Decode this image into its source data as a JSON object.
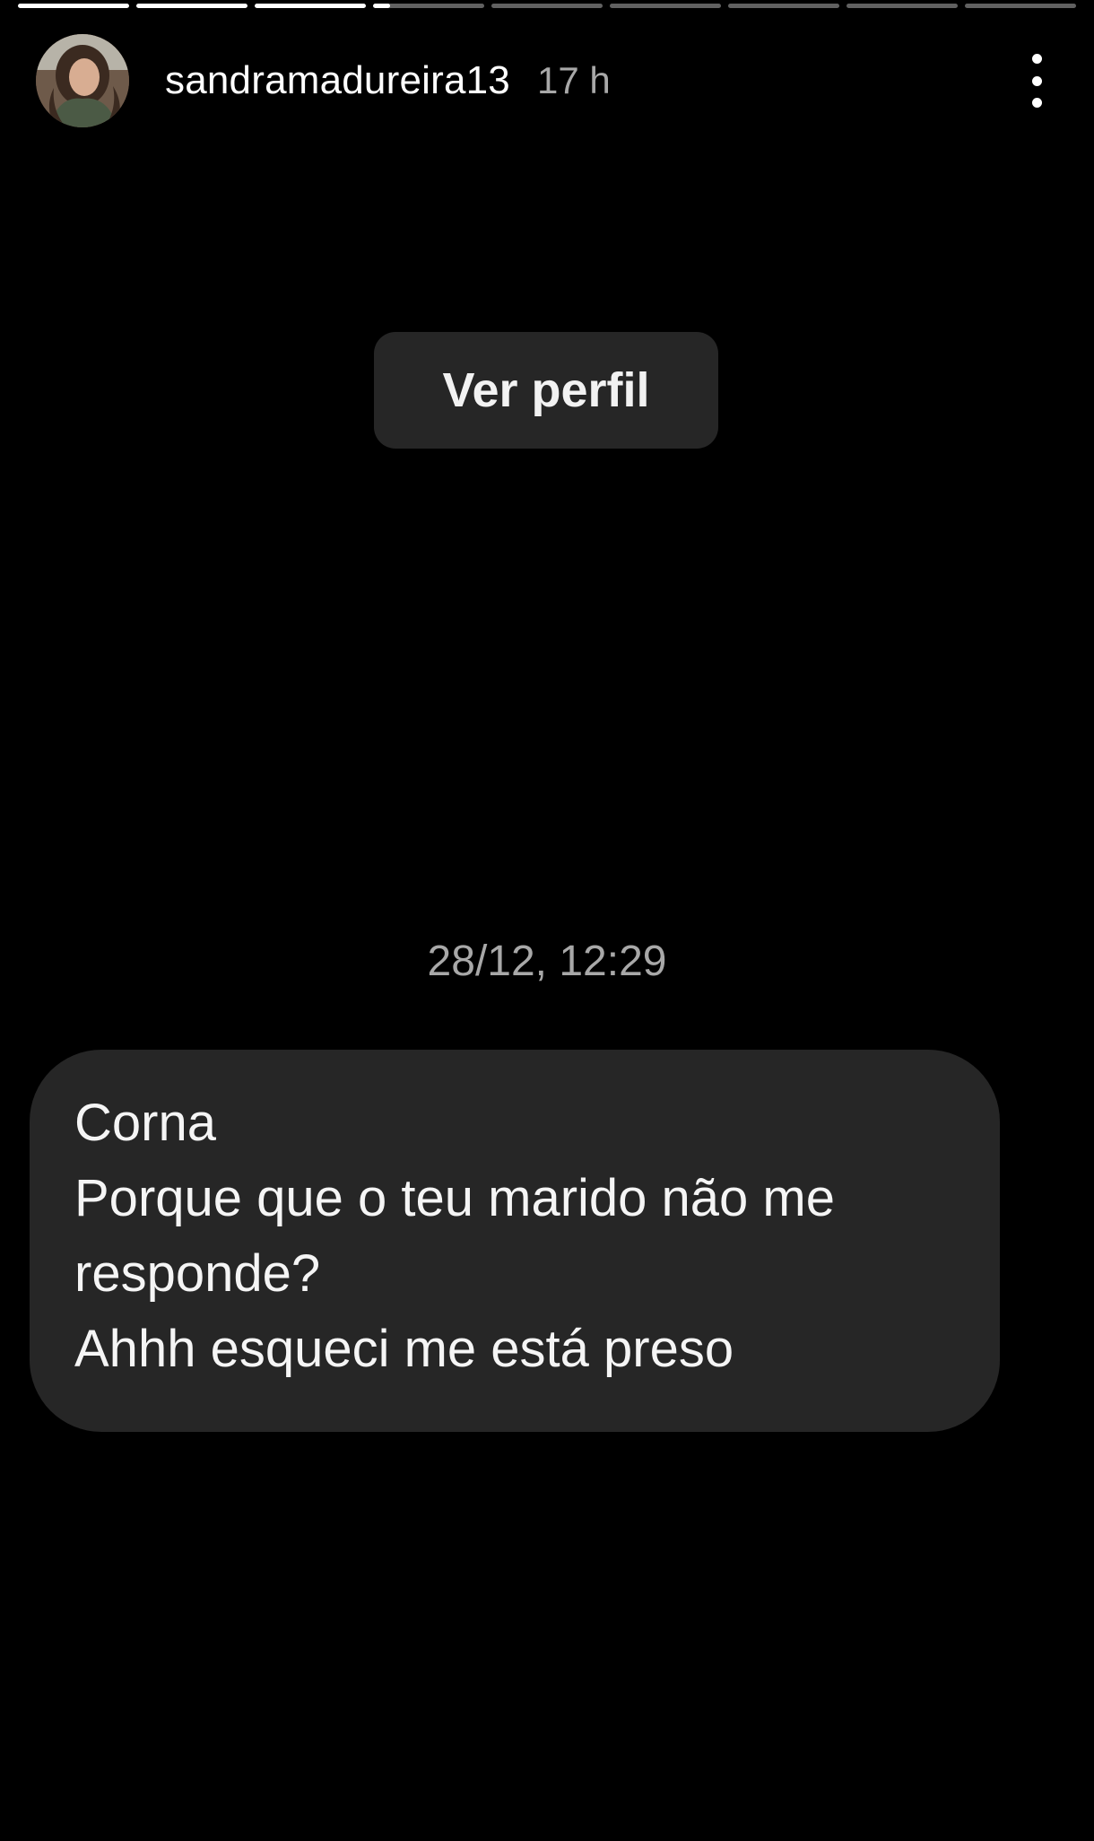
{
  "story": {
    "segments": [
      1,
      1,
      1,
      0.15,
      0,
      0,
      0,
      0,
      0
    ]
  },
  "header": {
    "username": "sandramadureira13",
    "time": "17 h",
    "avatar_icon": "profile-photo",
    "more_icon": "more-vertical-icon"
  },
  "view_profile_label": "Ver perfil",
  "conversation": {
    "timestamp": "28/12, 12:29",
    "message_lines": [
      "Corna",
      "Porque que o teu marido não me",
      "responde?",
      "Ahhh esqueci me está preso"
    ]
  },
  "colors": {
    "background": "#000000",
    "bubble": "#262626",
    "secondary_text": "#a8a8a8"
  }
}
